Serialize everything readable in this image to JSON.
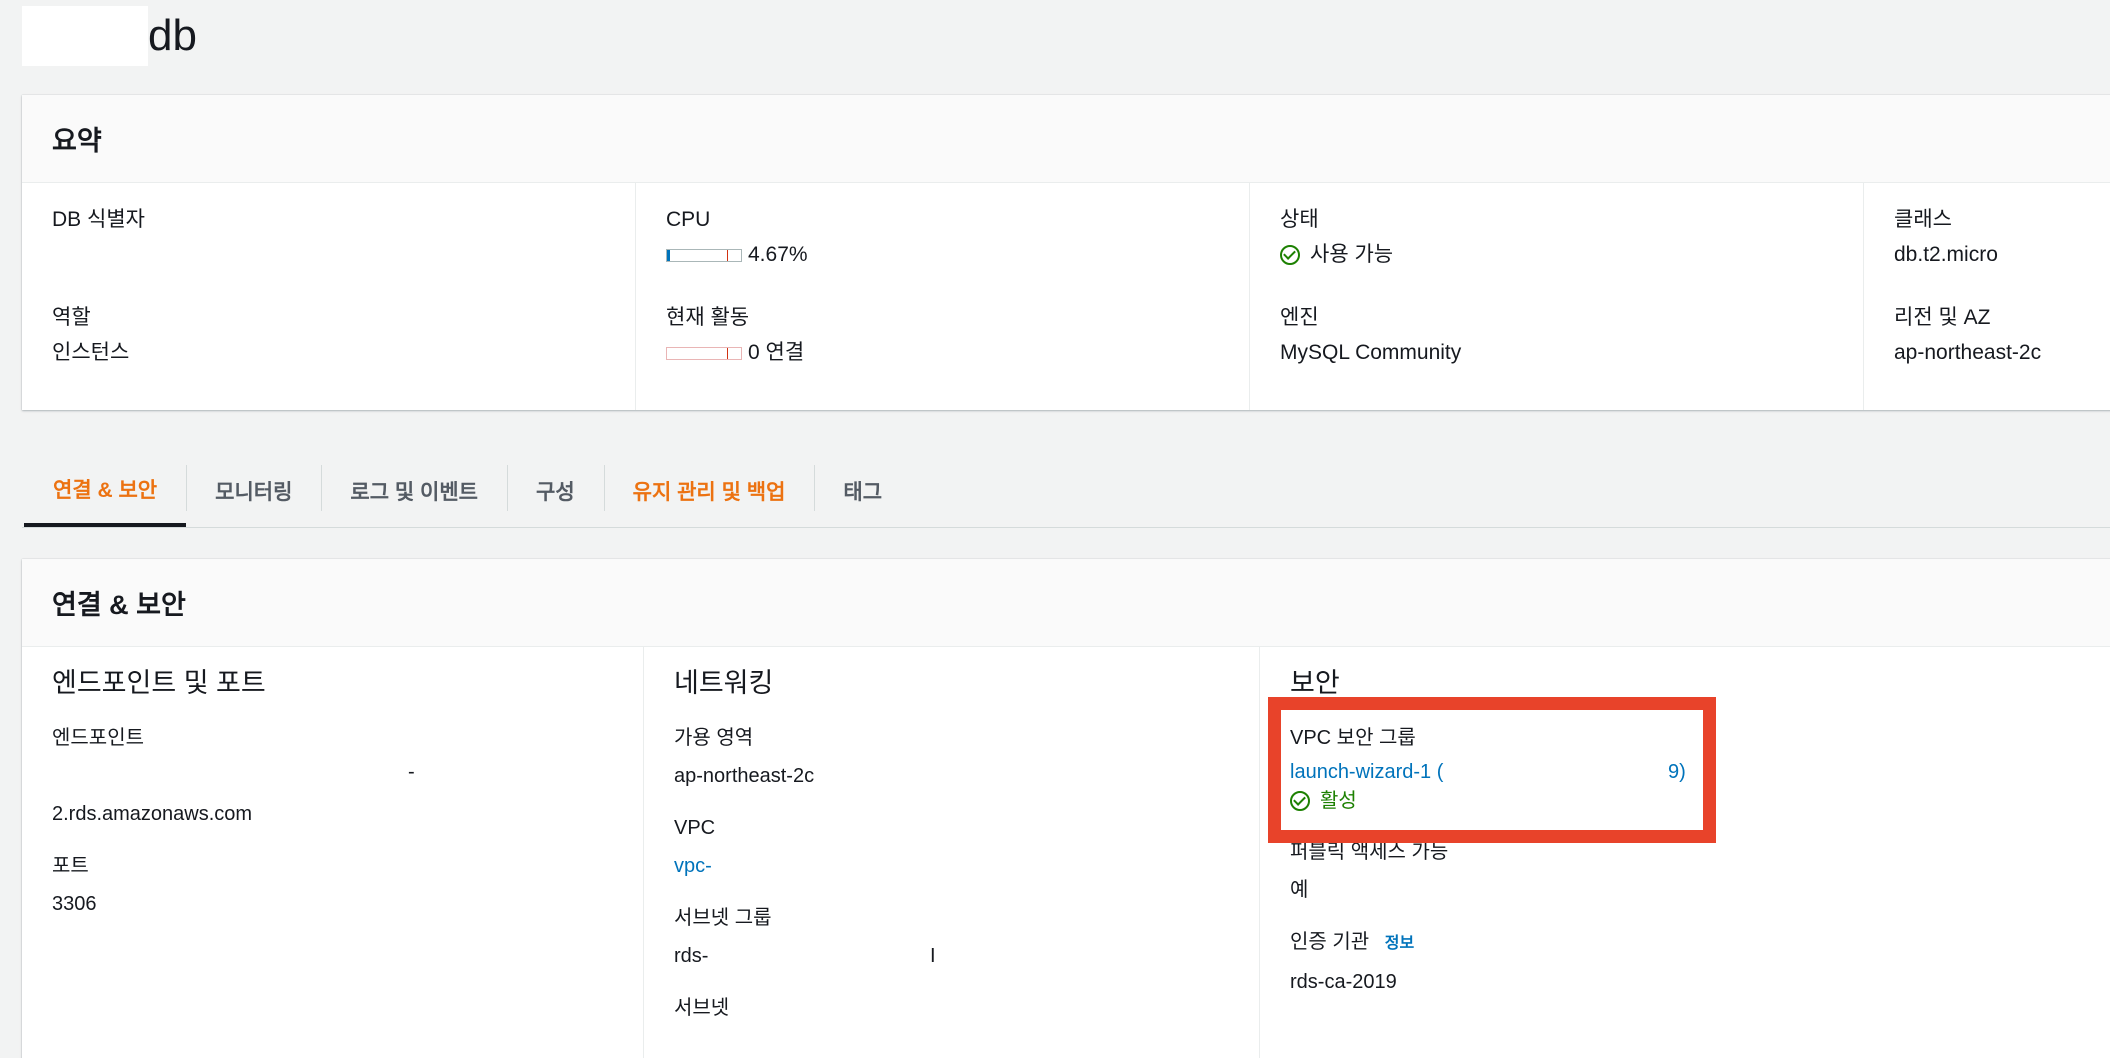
{
  "page": {
    "title": "db"
  },
  "summary": {
    "title": "요약",
    "fields": {
      "db_identifier": {
        "label": "DB 식별자",
        "value": ""
      },
      "role": {
        "label": "역할",
        "value": "인스턴스"
      },
      "cpu": {
        "label": "CPU",
        "value": "4.67%",
        "level_percent": 4.67
      },
      "current_activity": {
        "label": "현재 활동",
        "value": "0 연결",
        "level": 0
      },
      "status": {
        "label": "상태",
        "value": "사용 가능",
        "icon": "check-circle-icon",
        "color": "#1d8102"
      },
      "engine": {
        "label": "엔진",
        "value": "MySQL Community"
      },
      "class": {
        "label": "클래스",
        "value": "db.t2.micro"
      },
      "region_az": {
        "label": "리전 및 AZ",
        "value": "ap-northeast-2c"
      }
    }
  },
  "tabs": [
    {
      "label": "연결 & 보안",
      "active": true
    },
    {
      "label": "모니터링"
    },
    {
      "label": "로그 및 이벤트"
    },
    {
      "label": "구성"
    },
    {
      "label": "유지 관리 및 백업"
    },
    {
      "label": "태그"
    }
  ],
  "connectivity": {
    "title": "연결 & 보안",
    "endpoint_port": {
      "title": "엔드포인트 및 포트",
      "endpoint_label": "엔드포인트",
      "endpoint_line1": "-",
      "endpoint_line2": "2.rds.amazonaws.com",
      "port_label": "포트",
      "port_value": "3306"
    },
    "networking": {
      "title": "네트워킹",
      "az_label": "가용 영역",
      "az_value": "ap-northeast-2c",
      "vpc_label": "VPC",
      "vpc_value": "vpc-",
      "subnet_group_label": "서브넷 그룹",
      "subnet_group_value": "rds-",
      "subnet_group_tail": "I",
      "subnet_label": "서브넷"
    },
    "security": {
      "title": "보안",
      "vpc_sg_label": "VPC 보안 그룹",
      "vpc_sg_value_start": "launch-wizard-1 (",
      "vpc_sg_value_end": "9)",
      "vpc_sg_status": "활성",
      "public_access_label": "퍼블릭 액세스 가능",
      "public_access_value": "예",
      "ca_label": "인증 기관",
      "ca_info": "정보",
      "ca_value": "rds-ca-2019"
    }
  },
  "colors": {
    "accent_orange": "#ec7211",
    "link_blue": "#0073bb",
    "success_green": "#1d8102",
    "highlight_red": "#e8432a"
  }
}
